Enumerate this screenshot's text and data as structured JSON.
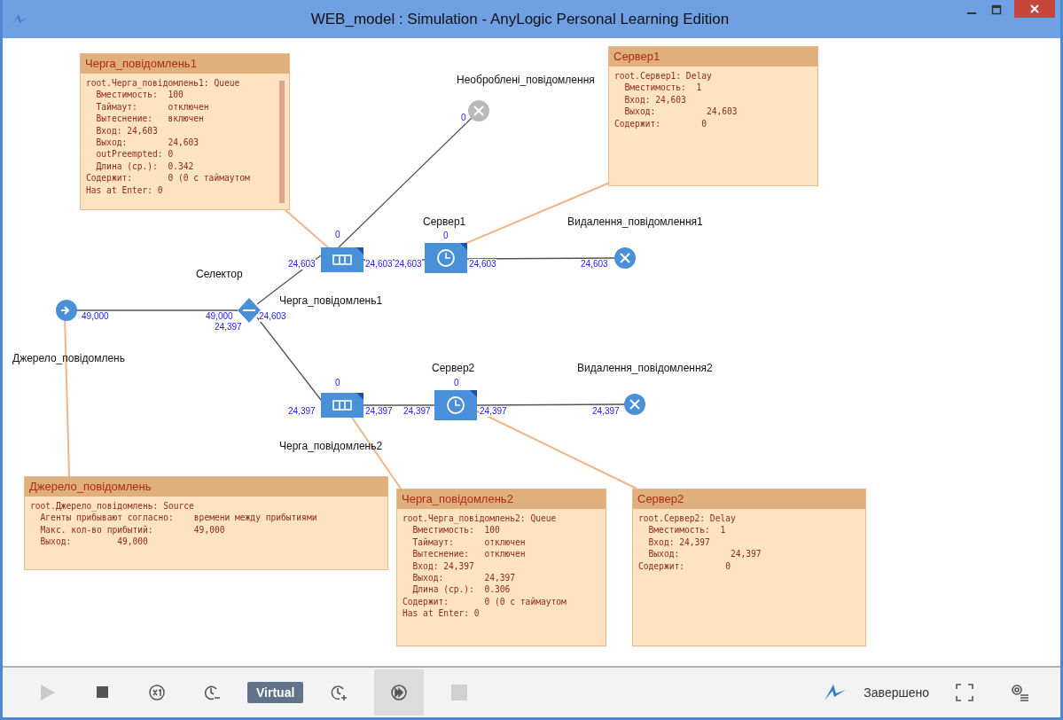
{
  "window": {
    "title": "WEB_model : Simulation - AnyLogic Personal Learning Edition"
  },
  "nodes": [
    {
      "kind": "source",
      "label": "Джерело_повідомлень",
      "active": true,
      "counts": [
        "49,000"
      ]
    },
    {
      "kind": "select",
      "label": "Селектор",
      "active": true,
      "counts": [
        "49,000",
        "24,603",
        "24,397"
      ]
    },
    {
      "kind": "queue",
      "label": "Черга_повідомлень1",
      "active": true,
      "counts": [
        "0",
        "24,603",
        "24,603"
      ]
    },
    {
      "kind": "delay",
      "label": "Сервер1",
      "active": true,
      "counts": [
        "0",
        "24,603",
        "24,603"
      ]
    },
    {
      "kind": "sink",
      "label": "Видалення_повідомлення1",
      "active": true,
      "counts": [
        "24,603"
      ]
    },
    {
      "kind": "sink",
      "label": "Необроблені_повідомлення",
      "active": false,
      "counts": [
        "0"
      ]
    },
    {
      "kind": "queue",
      "label": "Черга_повідомлень2",
      "active": true,
      "counts": [
        "0",
        "24,397",
        "24,397"
      ]
    },
    {
      "kind": "delay",
      "label": "Сервер2",
      "active": true,
      "counts": [
        "0",
        "24,397",
        "24,397"
      ]
    },
    {
      "kind": "sink",
      "label": "Видалення_повідомлення2",
      "active": true,
      "counts": [
        "24,397"
      ]
    }
  ],
  "callouts": [
    {
      "title": "Черга_повідомлень1",
      "scrollbar": true,
      "lines": [
        "root.Черга_повідомлень1: Queue",
        "  Вместимость:  100",
        "  Таймаут:      отключен",
        "  Вытеснение:   включен",
        "  Вход: 24,603",
        "  Выход:        24,603",
        "  outPreempted: 0",
        "  Длина (ср.):  0.342",
        "Содержит:       0 (0 с таймаутом",
        "Has at Enter: 0"
      ]
    },
    {
      "title": "Сервер1",
      "scrollbar": false,
      "lines": [
        "root.Сервер1: Delay",
        "  Вместимость:  1",
        "  Вход: 24,603",
        "  Выход:          24,603",
        "Содержит:        0"
      ]
    },
    {
      "title": "Джерело_повідомлень",
      "scrollbar": false,
      "lines": [
        "root.Джерело_повідомлень: Source",
        "  Агенты прибывают согласно:    времени между прибытиями",
        "  Макс. кол-во прибытий:        49,000",
        "  Выход:         49,000"
      ]
    },
    {
      "title": "Черга_повідомлень2",
      "scrollbar": false,
      "lines": [
        "root.Черга_повідомлень2: Queue",
        "  Вместимость:  100",
        "  Таймаут:      отключен",
        "  Вытеснение:   отключен",
        "  Вход: 24,397",
        "  Выход:        24,397",
        "  Длина (ср.):  0.306",
        "Содержит:       0 (0 с таймаутом",
        "Has at Enter: 0"
      ]
    },
    {
      "title": "Сервер2",
      "scrollbar": false,
      "lines": [
        "root.Сервер2: Delay",
        "  Вместимость:  1",
        "  Вход: 24,397",
        "  Выход:          24,397",
        "Содержит:        0"
      ]
    }
  ],
  "toolbar": {
    "buttons": [
      {
        "kind": "play",
        "disabled": true,
        "selected": false
      },
      {
        "kind": "stop",
        "disabled": false,
        "selected": false
      },
      {
        "kind": "speed",
        "disabled": false,
        "selected": false
      },
      {
        "kind": "slower",
        "disabled": false,
        "selected": false
      },
      {
        "kind": "mode",
        "label": "Virtual",
        "disabled": false,
        "selected": false
      },
      {
        "kind": "faster",
        "disabled": false,
        "selected": false
      },
      {
        "kind": "fast",
        "disabled": false,
        "selected": true
      },
      {
        "kind": "step",
        "disabled": true,
        "selected": false
      }
    ],
    "status": "Завершено"
  }
}
